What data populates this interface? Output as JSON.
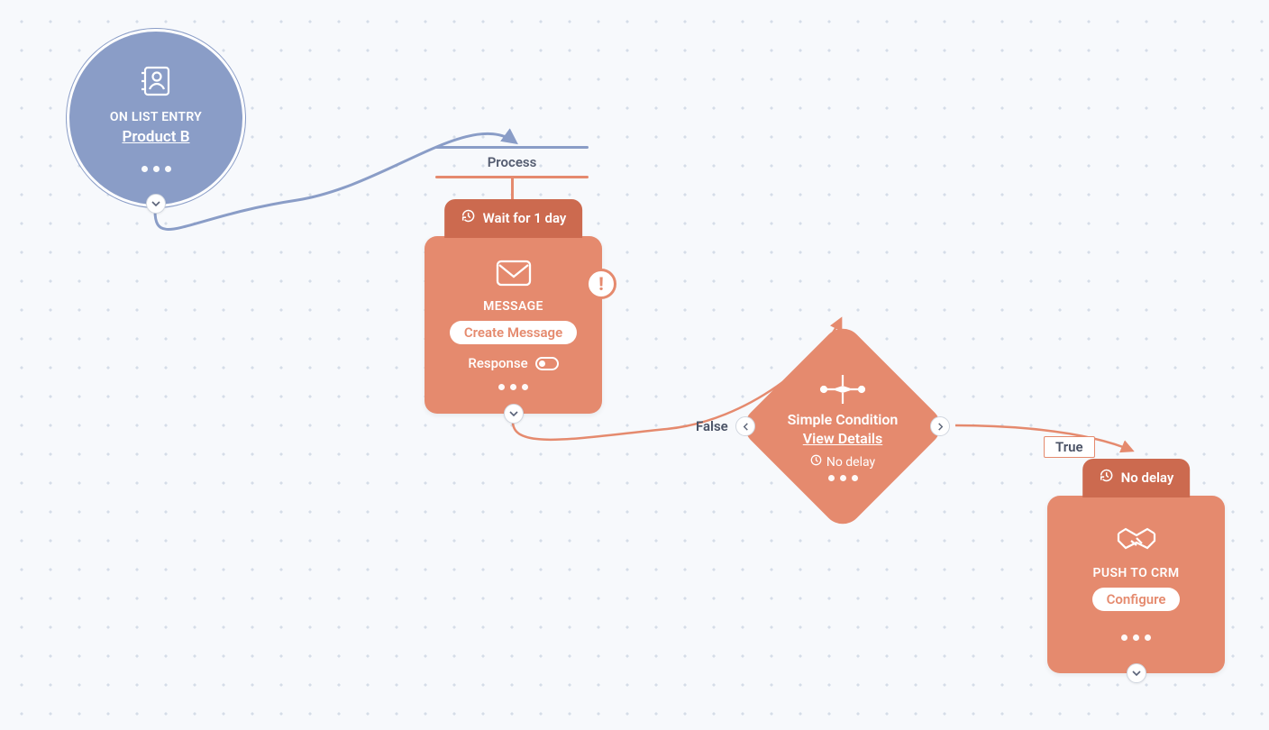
{
  "process_label": "Process",
  "trigger": {
    "type_label": "ON LIST ENTRY",
    "name": "Product B"
  },
  "message_node": {
    "wait_label": "Wait for 1 day",
    "type_label": "MESSAGE",
    "button_label": "Create Message",
    "response_label": "Response",
    "response_on": false
  },
  "condition_node": {
    "title": "Simple Condition",
    "link_label": "View Details",
    "delay_label": "No delay",
    "false_label": "False",
    "true_label": "True"
  },
  "crm_node": {
    "wait_label": "No delay",
    "type_label": "PUSH TO CRM",
    "button_label": "Configure"
  },
  "colors": {
    "blue": "#8a9dc7",
    "orange": "#e58a6e",
    "orange_dark": "#cc6a4f",
    "bg": "#f7f9fc"
  }
}
